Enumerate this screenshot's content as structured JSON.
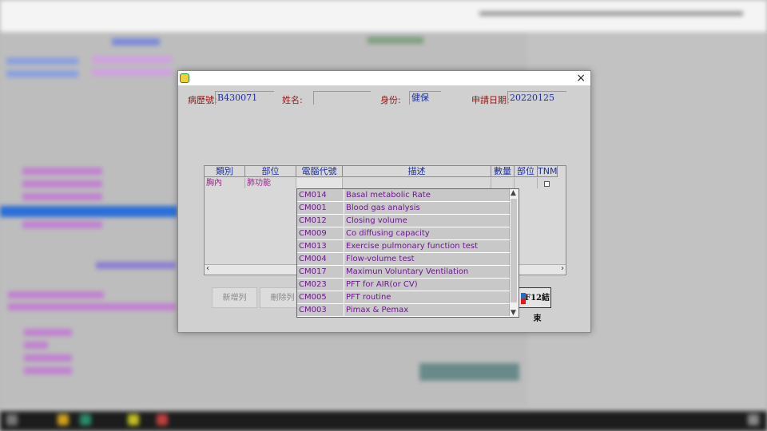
{
  "dialog": {
    "close_glyph": "×",
    "fields": {
      "chart_no_label": "病歷號:",
      "chart_no_value": "B430071",
      "name_label": "姓名:",
      "name_value": "",
      "identity_label": "身份:",
      "identity_value": "健保",
      "apply_date_label": "申請日期:",
      "apply_date_value": "20220125"
    },
    "table": {
      "columns": [
        "類別",
        "部位",
        "電腦代號",
        "描述",
        "數量",
        "部位",
        "TNM"
      ],
      "rows": [
        {
          "category": "胸內",
          "site": "肺功能",
          "code": "",
          "description": "",
          "qty": "",
          "site2": "",
          "tnm_checked": false
        }
      ]
    },
    "buttons": {
      "add_row": "新增列",
      "delete_row": "刪除列",
      "end": "F12結束"
    },
    "dropdown": {
      "items": [
        {
          "code": "CM014",
          "description": "Basal metabolic Rate"
        },
        {
          "code": "CM001",
          "description": "Blood gas analysis"
        },
        {
          "code": "CM012",
          "description": "Closing volume"
        },
        {
          "code": "CM009",
          "description": "Co diffusing capacity"
        },
        {
          "code": "CM013",
          "description": "Exercise pulmonary function test"
        },
        {
          "code": "CM004",
          "description": "Flow-volume test"
        },
        {
          "code": "CM017",
          "description": "Maximun Voluntary Ventilation"
        },
        {
          "code": "CM023",
          "description": "PFT for AIR(or CV)"
        },
        {
          "code": "CM005",
          "description": "PFT routine"
        },
        {
          "code": "CM003",
          "description": "Pimax & Pemax"
        }
      ]
    }
  },
  "colors": {
    "label_red": "#8b1a1a",
    "value_blue": "#1f2f9e",
    "item_purple": "#6a1a8a"
  }
}
